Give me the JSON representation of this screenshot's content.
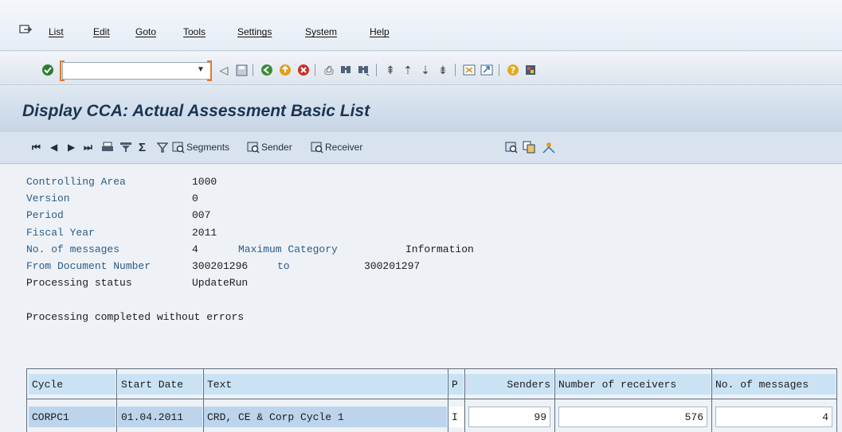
{
  "menu": {
    "items": [
      "List",
      "Edit",
      "Goto",
      "Tools",
      "Settings",
      "System",
      "Help"
    ]
  },
  "toolbar": {
    "command_field_value": ""
  },
  "page": {
    "title": "Display CCA: Actual Assessment Basic List"
  },
  "app_toolbar": {
    "segments_label": "Segments",
    "sender_label": "Sender",
    "receiver_label": "Receiver"
  },
  "header_info": {
    "controlling_area_label": "Controlling Area",
    "controlling_area_value": "1000",
    "version_label": "Version",
    "version_value": "0",
    "period_label": "Period",
    "period_value": "007",
    "fiscal_year_label": "Fiscal Year",
    "fiscal_year_value": "2011",
    "messages_label": "No. of messages",
    "messages_value": "4",
    "max_category_label": "Maximum Category",
    "max_category_value": "Information",
    "from_doc_label": "From Document Number",
    "from_doc_value": "300201296",
    "to_label": "to",
    "to_value": "300201297",
    "processing_status_label": "Processing status",
    "processing_status_value": "UpdateRun",
    "completion_message": "Processing completed without errors"
  },
  "table": {
    "columns": [
      "Cycle",
      "Start Date",
      "Text",
      "P",
      "Senders",
      "Number of receivers",
      "No. of messages"
    ],
    "rows": [
      {
        "cycle": "CORPC1",
        "start_date": "01.04.2011",
        "text": "CRD, CE & Corp Cycle 1",
        "p": "I",
        "senders": "99",
        "receivers": "576",
        "messages": "4"
      }
    ]
  },
  "colors": {
    "title_text": "#1a3550",
    "label_blue": "#2c5b86",
    "header_cell": "#c9e3f4",
    "accent_orange": "#e07a2a"
  }
}
